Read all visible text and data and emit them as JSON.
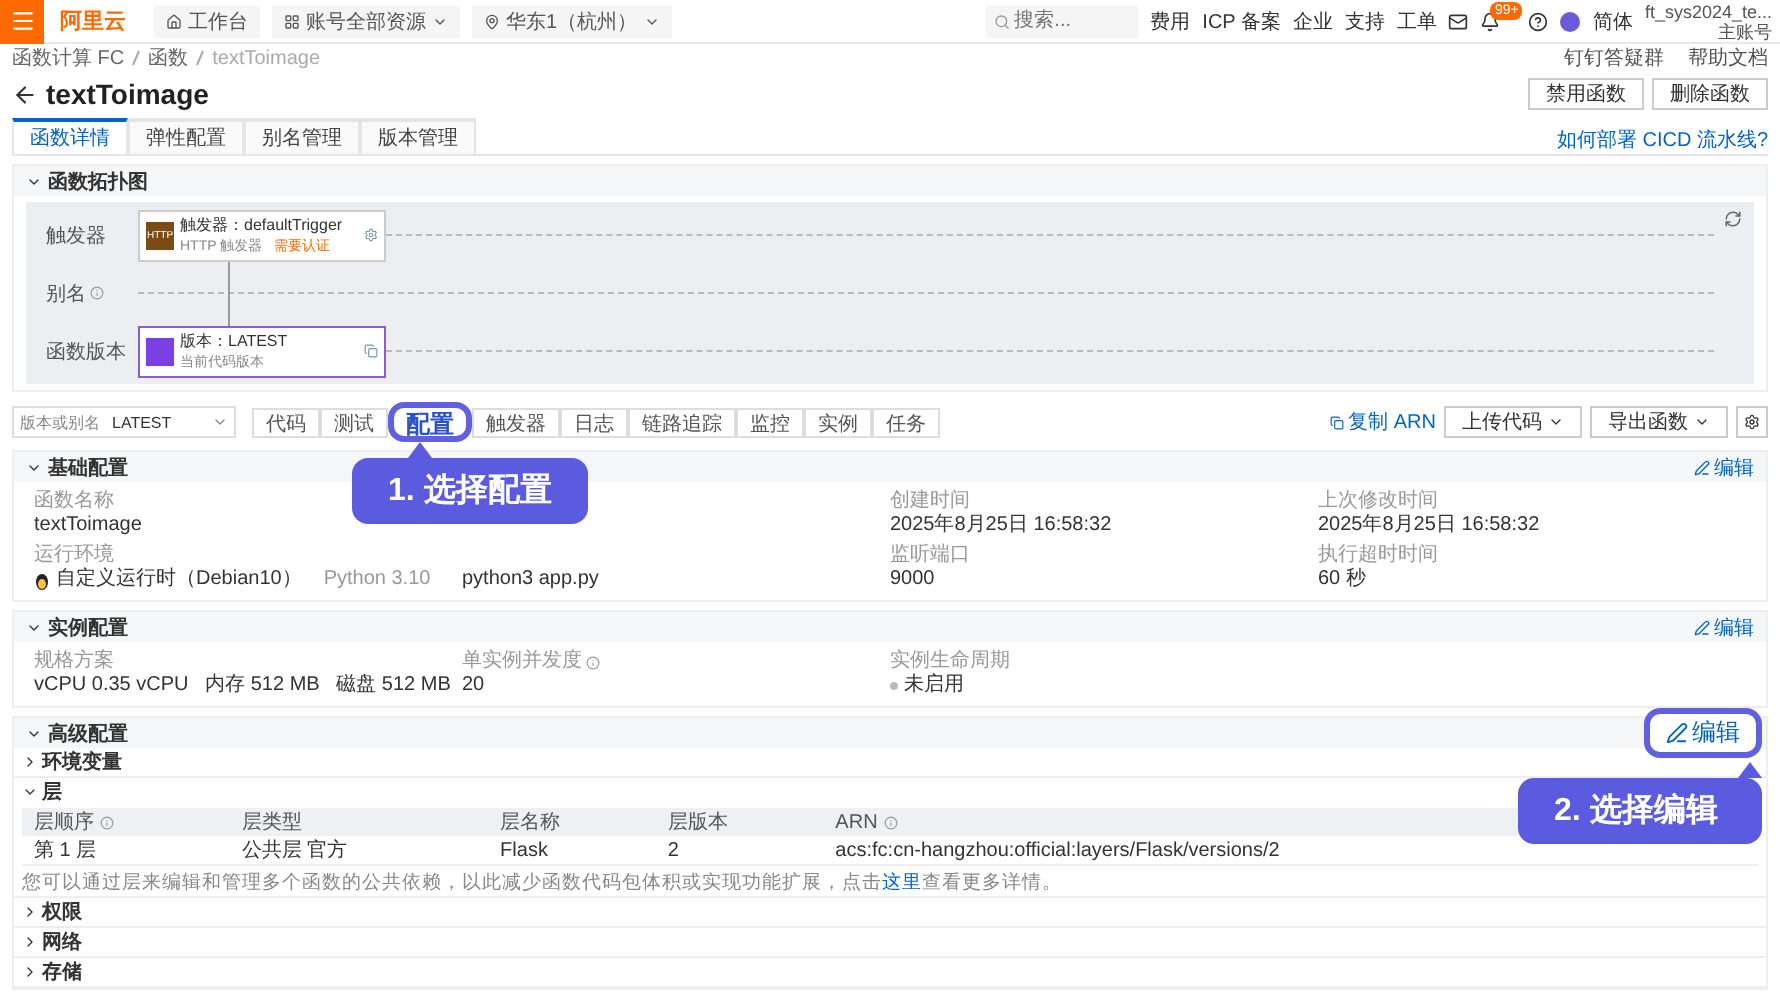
{
  "topbar": {
    "logo": "阿里云",
    "workbench": "工作台",
    "resource": "账号全部资源",
    "region": "华东1（杭州）",
    "search": {
      "placeholder": "搜索..."
    },
    "links": [
      "费用",
      "ICP 备案",
      "企业",
      "支持",
      "工单"
    ],
    "badge": "99+",
    "language": "简体",
    "user": {
      "name": "ft_sys2024_te...",
      "role": "主账号"
    }
  },
  "breadcrumb": [
    "函数计算 FC",
    "函数",
    "textToimage"
  ],
  "help_links": [
    "钉钉答疑群",
    "帮助文档"
  ],
  "title": "textToimage",
  "actions": [
    "禁用函数",
    "删除函数"
  ],
  "tabs": [
    {
      "label": "函数详情",
      "selected": true
    },
    {
      "label": "弹性配置",
      "selected": false
    },
    {
      "label": "别名管理",
      "selected": false
    },
    {
      "label": "版本管理",
      "selected": false
    }
  ],
  "cicd_link": "如何部署 CICD 流水线?",
  "topology": {
    "title": "函数拓扑图",
    "expanded": true,
    "rows": [
      {
        "label": "触发器",
        "info": false
      },
      {
        "label": "别名",
        "info": true
      },
      {
        "label": "函数版本",
        "info": false
      }
    ],
    "trigger_node": {
      "badge": "HTTP",
      "title": "触发器：defaultTrigger",
      "type": "HTTP 触发器",
      "auth": "需要认证"
    },
    "version_node": {
      "title": "版本：LATEST",
      "subtitle": "当前代码版本"
    }
  },
  "toolbar": {
    "version_select": {
      "label": "版本或别名",
      "value": "LATEST"
    },
    "tabs": [
      {
        "label": "代码",
        "selected": false
      },
      {
        "label": "测试",
        "selected": false
      },
      {
        "label": "配置",
        "selected": true
      },
      {
        "label": "触发器",
        "selected": false
      },
      {
        "label": "日志",
        "selected": false
      },
      {
        "label": "链路追踪",
        "selected": false
      },
      {
        "label": "监控",
        "selected": false
      },
      {
        "label": "实例",
        "selected": false
      },
      {
        "label": "任务",
        "selected": false
      }
    ],
    "copy_arn": "复制 ARN",
    "upload": "上传代码",
    "export": "导出函数"
  },
  "sections": [
    {
      "title": "基础配置",
      "expanded": true,
      "edit": "编辑",
      "edit_highlighted": false,
      "fields": [
        {
          "label": "函数名称",
          "value": "textToimage"
        },
        {
          "label": "创建时间",
          "value": "2025年8月25日 16:58:32"
        },
        {
          "label": "上次修改时间",
          "value": "2025年8月25日 16:58:32"
        },
        {
          "label": "运行环境",
          "value": "自定义运行时（Debian10）",
          "note": "Python 3.10",
          "kind": "runtime"
        },
        {
          "value": "python3 app.py"
        },
        {
          "label": "监听端口",
          "value": "9000"
        },
        {
          "label": "执行超时时间",
          "value": "60 秒"
        }
      ]
    },
    {
      "title": "实例配置",
      "expanded": true,
      "edit": "编辑",
      "edit_highlighted": false,
      "fields": [
        {
          "label": "规格方案",
          "value": "vCPU 0.35 vCPU   内存 512 MB   磁盘 512 MB"
        },
        {
          "label": "单实例并发度",
          "value": "20",
          "info": true
        },
        {
          "label": "实例生命周期",
          "value": "未启用",
          "kind": "status"
        }
      ]
    }
  ],
  "advanced": {
    "title": "高级配置",
    "expanded": true,
    "edit": "编辑",
    "edit_highlighted": true,
    "groups": [
      {
        "title": "环境变量",
        "expanded": false
      },
      {
        "title": "层",
        "expanded": true,
        "table": {
          "columns": [
            {
              "label": "层顺序",
              "info": true
            },
            {
              "label": "层类型",
              "info": false
            },
            {
              "label": "层名称",
              "info": false
            },
            {
              "label": "层版本",
              "info": false
            },
            {
              "label": "ARN",
              "info": true
            }
          ],
          "rows": [
            [
              "第 1 层",
              "公共层 官方",
              "Flask",
              "2",
              "acs:fc:cn-hangzhou:official:layers/Flask/versions/2"
            ]
          ]
        },
        "note": {
          "text": "您可以通过层来编辑和管理多个函数的公共依赖，以此减少函数代码包体积或实现功能扩展，点击",
          "link": "这里",
          "after": "查看更多详情。"
        }
      },
      {
        "title": "权限",
        "expanded": false
      },
      {
        "title": "网络",
        "expanded": false
      },
      {
        "title": "存储",
        "expanded": false
      }
    ]
  },
  "callouts": [
    {
      "text": "1. 选择配置"
    },
    {
      "text": "2. 选择编辑"
    }
  ]
}
